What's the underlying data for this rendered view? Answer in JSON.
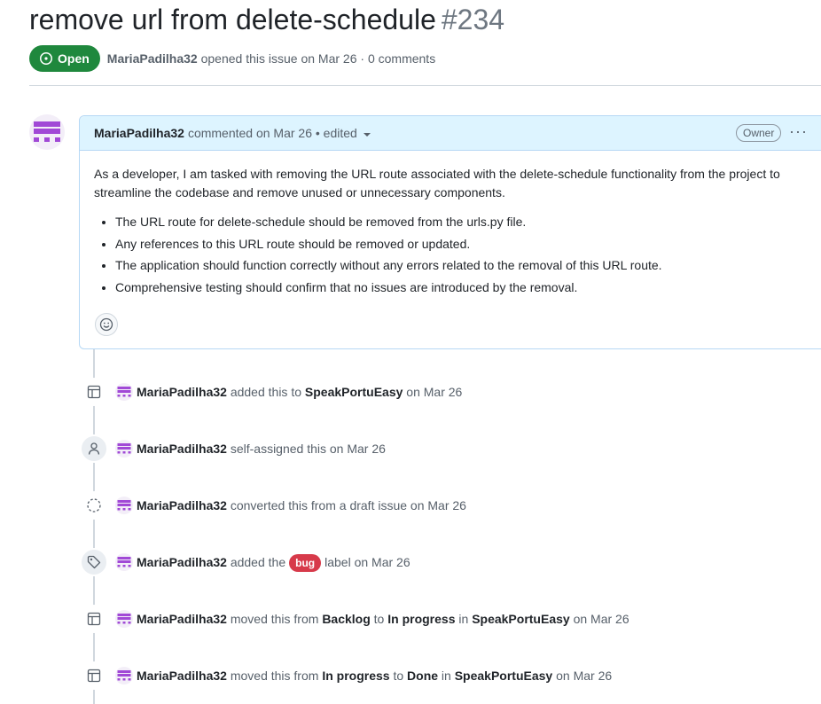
{
  "issue": {
    "title": "remove url from delete-schedule",
    "number": "#234",
    "state": "Open",
    "author": "MariaPadilha32",
    "opened_text": "opened this issue on Mar 26 · 0 comments"
  },
  "comment": {
    "author": "MariaPadilha32",
    "header_text": "commented on Mar 26 • edited",
    "role_badge": "Owner",
    "more_label": "···",
    "body_paragraph": "As a developer, I am tasked with removing the URL route associated with the delete-schedule functionality from the project to streamline the codebase and remove unused or unnecessary components.",
    "bullets": [
      "The URL route for delete-schedule should be removed from the urls.py file.",
      "Any references to this URL route should be removed or updated.",
      "The application should function correctly without any errors related to the removal of this URL route.",
      "Comprehensive testing should confirm that no issues are introduced by the removal."
    ]
  },
  "timeline": [
    {
      "icon": "project-table-icon",
      "author": "MariaPadilha32",
      "t1": "added this to",
      "s1": "SpeakPortuEasy",
      "t2": "on Mar 26"
    },
    {
      "icon": "person-icon",
      "author": "MariaPadilha32",
      "t1": "self-assigned this on Mar 26"
    },
    {
      "icon": "draft-issue-icon",
      "author": "MariaPadilha32",
      "t1": "converted this from a draft issue on Mar 26"
    },
    {
      "icon": "tag-icon",
      "author": "MariaPadilha32",
      "t1": "added the",
      "label": "bug",
      "t2": "label on Mar 26"
    },
    {
      "icon": "project-table-icon",
      "author": "MariaPadilha32",
      "t1": "moved this from",
      "s1": "Backlog",
      "t2": "to",
      "s2": "In progress",
      "t3": "in",
      "s3": "SpeakPortuEasy",
      "t4": "on Mar 26"
    },
    {
      "icon": "project-table-icon",
      "author": "MariaPadilha32",
      "t1": "moved this from",
      "s1": "In progress",
      "t2": "to",
      "s2": "Done",
      "t3": "in",
      "s3": "SpeakPortuEasy",
      "t4": "on Mar 26"
    }
  ],
  "colors": {
    "open_green": "#1f883d",
    "header_blue": "#ddf4ff",
    "bug_red": "#d73a4a",
    "avatar_purple": "#a149d6"
  }
}
